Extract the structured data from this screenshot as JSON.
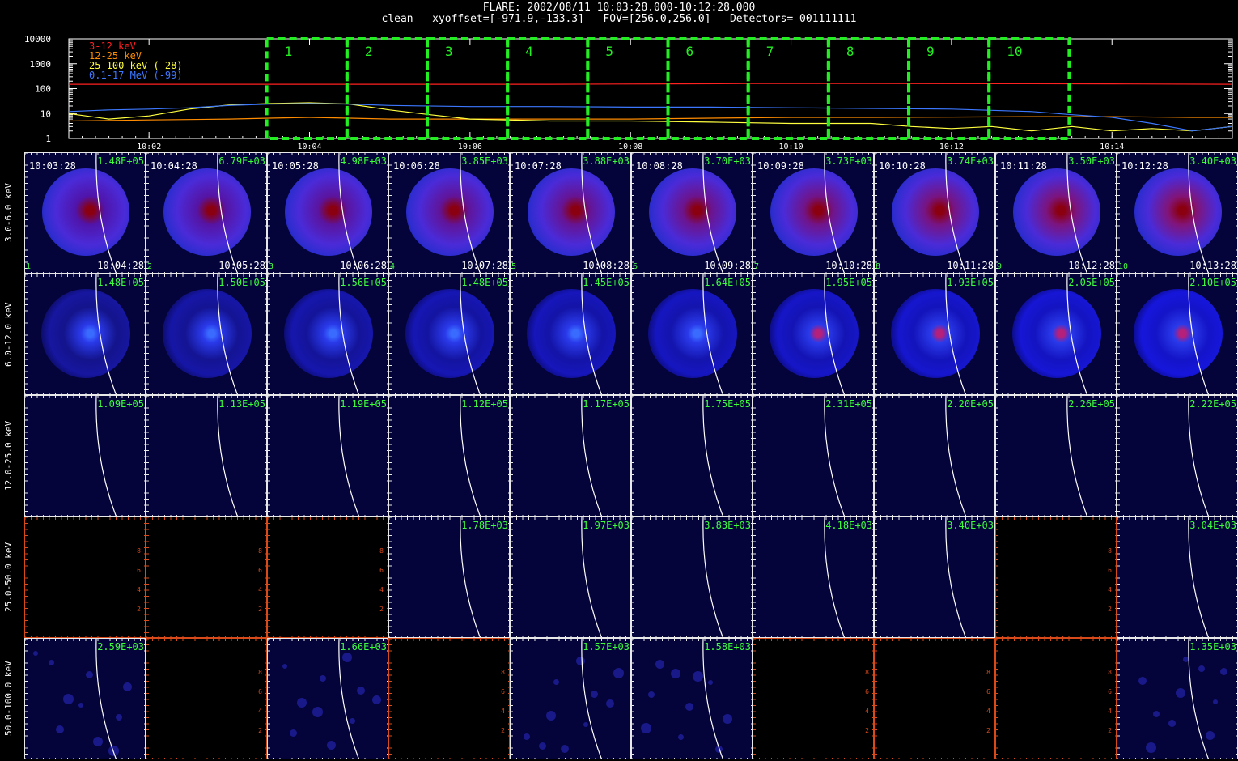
{
  "header": {
    "title": "FLARE: 2002/08/11 10:03:28.000-10:12:28.000",
    "subtitle": "clean   xyoffset=[-971.9,-133.3]   FOV=[256.0,256.0]   Detectors= 001111111"
  },
  "colors": {
    "band_3_12": "#ff2020",
    "band_12_25": "#ff8c00",
    "band_25_100": "#ffff40",
    "band_01_17": "#3c78ff",
    "interval_box": "#22ee22",
    "image_bg": "#04043a",
    "empty_frame": "#d84a1a",
    "peak_text": "#3cff3c"
  },
  "chart_data": [
    {
      "type": "line",
      "title": "FLARE: 2002/08/11 10:03:28.000-10:12:28.000",
      "y_scale": "log",
      "ylim": [
        1,
        10000
      ],
      "y_ticks": [
        "1",
        "10",
        "100",
        "1000",
        "10000"
      ],
      "xlim": [
        "10:01:00",
        "10:15:30"
      ],
      "x_ticks": [
        "10:02",
        "10:04",
        "10:06",
        "10:08",
        "10:10",
        "10:12",
        "10:14"
      ],
      "x_tick_minutes": [
        2,
        4,
        6,
        8,
        10,
        12,
        14
      ],
      "x_start_minute": 1.0,
      "x_end_minute": 15.5,
      "series": [
        {
          "name": "3-12 keV",
          "color": "#ff2020",
          "x": [
            1.0,
            3.0,
            5.0,
            7.0,
            8.5,
            9.5,
            11.0,
            12.5,
            14.0,
            15.5
          ],
          "y": [
            150,
            150,
            150,
            150,
            155,
            160,
            160,
            158,
            155,
            150
          ]
        },
        {
          "name": "12-25 keV",
          "color": "#ff8c00",
          "x": [
            1.0,
            2.0,
            3.0,
            3.5,
            4.0,
            4.5,
            5.0,
            6.0,
            7.0,
            8.0,
            9.0,
            10.0,
            11.0,
            12.0,
            13.0,
            14.0,
            15.0,
            15.5
          ],
          "y": [
            5,
            5.5,
            6,
            6.5,
            7,
            6.5,
            6,
            6,
            6,
            6,
            6.5,
            7,
            7,
            7.2,
            7.5,
            7.5,
            7,
            7
          ]
        },
        {
          "name": "25-100 keV (-28)",
          "color": "#ffff40",
          "x": [
            1.0,
            1.5,
            2.0,
            2.5,
            3.0,
            3.5,
            4.0,
            4.5,
            5.0,
            5.5,
            6.0,
            7.0,
            8.0,
            9.0,
            10.0,
            11.0,
            11.5,
            12.0,
            12.5,
            13.0,
            13.5,
            14.0,
            14.5,
            15.0,
            15.5
          ],
          "y": [
            10,
            6,
            8,
            15,
            22,
            25,
            27,
            24,
            14,
            9,
            6,
            5,
            5,
            4.5,
            4,
            4,
            3,
            2.5,
            3,
            2,
            3,
            2,
            2.5,
            2,
            3
          ]
        },
        {
          "name": "0.1-17 MeV (-99)",
          "color": "#3c78ff",
          "x": [
            1.0,
            1.5,
            2.0,
            2.5,
            3.0,
            3.5,
            4.0,
            4.5,
            5.0,
            6.0,
            7.0,
            8.0,
            9.0,
            10.0,
            11.0,
            12.0,
            13.0,
            13.5,
            14.0,
            14.5,
            15.0,
            15.5
          ],
          "y": [
            12,
            14,
            15,
            17,
            21,
            24,
            25,
            24,
            21,
            19,
            19,
            18,
            18,
            17,
            16,
            15,
            12,
            9,
            7,
            4,
            2,
            3
          ]
        }
      ],
      "intervals": [
        {
          "label": "1",
          "start": 3.467,
          "end": 4.467
        },
        {
          "label": "2",
          "start": 4.467,
          "end": 5.467
        },
        {
          "label": "3",
          "start": 5.467,
          "end": 6.467
        },
        {
          "label": "4",
          "start": 6.467,
          "end": 7.467
        },
        {
          "label": "5",
          "start": 7.467,
          "end": 8.467
        },
        {
          "label": "6",
          "start": 8.467,
          "end": 9.467
        },
        {
          "label": "7",
          "start": 9.467,
          "end": 10.467
        },
        {
          "label": "8",
          "start": 10.467,
          "end": 11.467
        },
        {
          "label": "9",
          "start": 11.467,
          "end": 12.467
        },
        {
          "label": "10",
          "start": 12.467,
          "end": 13.467
        }
      ]
    },
    {
      "type": "heatmap",
      "energy_bands": [
        "3.0-6.0 keV",
        "6.0-12.0 keV",
        "12.0-25.0 keV",
        "25.0-50.0 keV",
        "50.0-100.0 keV"
      ],
      "time_bins": [
        {
          "index": "1",
          "start": "10:03:28",
          "end": "10:04:28"
        },
        {
          "index": "2",
          "start": "10:04:28",
          "end": "10:05:28"
        },
        {
          "index": "3",
          "start": "10:05:28",
          "end": "10:06:28"
        },
        {
          "index": "4",
          "start": "10:06:28",
          "end": "10:07:28"
        },
        {
          "index": "5",
          "start": "10:07:28",
          "end": "10:08:28"
        },
        {
          "index": "6",
          "start": "10:08:28",
          "end": "10:09:28"
        },
        {
          "index": "7",
          "start": "10:09:28",
          "end": "10:10:28"
        },
        {
          "index": "8",
          "start": "10:10:28",
          "end": "10:11:28"
        },
        {
          "index": "9",
          "start": "10:11:28",
          "end": "10:12:28"
        },
        {
          "index": "10",
          "start": "10:12:28",
          "end": "10:13:28"
        }
      ],
      "peaks": [
        [
          "1.48E+05",
          "6.79E+03",
          "4.98E+03",
          "3.85E+03",
          "3.88E+03",
          "3.70E+03",
          "3.73E+03",
          "3.74E+03",
          "3.50E+03",
          "3.40E+03"
        ],
        [
          "1.48E+05",
          "1.50E+05",
          "1.56E+05",
          "1.48E+05",
          "1.45E+05",
          "1.64E+05",
          "1.95E+05",
          "1.93E+05",
          "2.05E+05",
          "2.10E+05"
        ],
        [
          "1.09E+05",
          "1.13E+05",
          "1.19E+05",
          "1.12E+05",
          "1.17E+05",
          "1.75E+05",
          "2.31E+05",
          "2.20E+05",
          "2.26E+05",
          "2.22E+05"
        ],
        [
          "",
          "",
          "",
          "1.78E+03",
          "1.97E+03",
          "3.83E+03",
          "4.18E+03",
          "3.40E+03",
          "",
          "3.04E+03"
        ],
        [
          "2.59E+03",
          "",
          "1.66E+03",
          "",
          "1.57E+03",
          "1.58E+03",
          "",
          "",
          "",
          "1.35E+03"
        ]
      ],
      "has_image": [
        [
          true,
          true,
          true,
          true,
          true,
          true,
          true,
          true,
          true,
          true
        ],
        [
          true,
          true,
          true,
          true,
          true,
          true,
          true,
          true,
          true,
          true
        ],
        [
          true,
          true,
          true,
          true,
          true,
          true,
          true,
          true,
          true,
          true
        ],
        [
          false,
          false,
          false,
          true,
          true,
          true,
          true,
          true,
          false,
          true
        ],
        [
          true,
          false,
          true,
          false,
          true,
          true,
          false,
          false,
          false,
          true
        ]
      ],
      "empty_axis_ticks": [
        "2",
        "4",
        "6",
        "8"
      ]
    }
  ]
}
